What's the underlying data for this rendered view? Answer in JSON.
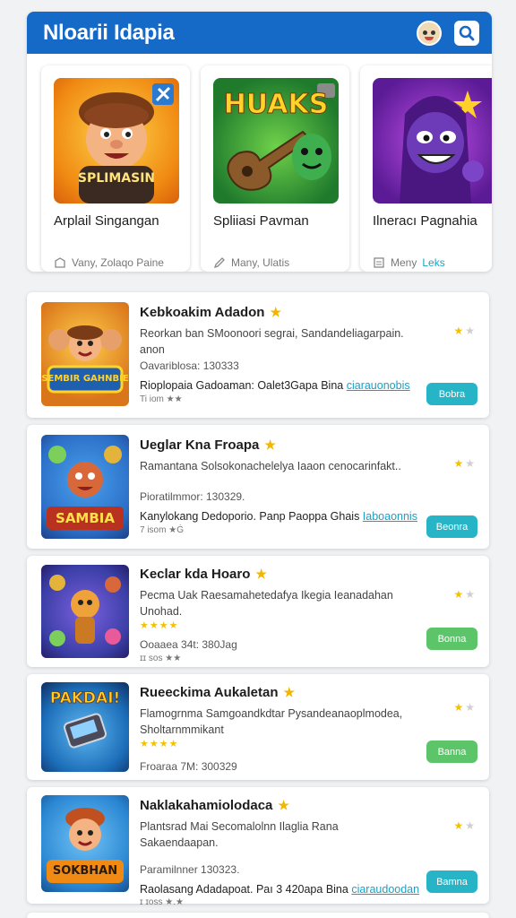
{
  "app": {
    "title": "Nloarii Idapia"
  },
  "header": {
    "avatar": "avatar",
    "search_icon": "search-icon"
  },
  "featured": [
    {
      "name": "Arplail Singangan",
      "meta": "Vany, Zolaqo Paine",
      "meta_icon": "shield-icon",
      "art_label": "SPLIMASIN",
      "bg": "#f7a21b",
      "accent": ""
    },
    {
      "name": "Spliiasi Pavman",
      "meta": "Many, Ulatis",
      "meta_icon": "pencil-icon",
      "art_label": "HUAKS",
      "bg": "#2e8c3a",
      "accent": ""
    },
    {
      "name": "Ilneracı Pagnahia",
      "meta": "Meny",
      "meta_icon": "list-icon",
      "art_label": "",
      "bg": "#7a2bb4",
      "accent": "Leks"
    }
  ],
  "list": [
    {
      "title": "Kebkoakim Adadon",
      "desc": "Reorkan ban SMoonoori segrai, Sandandeliagarpain. anon",
      "line": "Oavariblosa: 130333",
      "link_text": "Rioplopaia Gadoaman: Oalet3Gapa Bina",
      "link_u": "ciarauonobis",
      "small": "Ti iom ★★",
      "stars": "",
      "button": "Bobra",
      "btn_color": "#27b4c7",
      "art_label": "SEMBIR GAHNBIE",
      "bg": "#d9751a"
    },
    {
      "title": "Ueglar Kna Froapa",
      "desc": "Ramantana Solsokonachelelya Iaaon cenocarinfakt..",
      "line": "Pioratilmmor: 130329.",
      "link_text": "Kanylokang Dedoporio. Panp Paoppa Ghais",
      "link_u": "Iaboaonnis",
      "small": "7 isom ★Ġ",
      "stars": "",
      "button": "Beonra",
      "btn_color": "#27b4c7",
      "art_label": "SAMBIA",
      "bg": "#2b6ec6"
    },
    {
      "title": "Keclar kda Hoaro",
      "desc": "Pecma Uak Raesamahetedafya Ikegia Ieanadahan Unohad.",
      "line": "Ooaaea 34t: 380Jag",
      "link_text": "",
      "link_u": "",
      "small": "ɪɪ sos ★★",
      "stars": "★★★★",
      "button": "Bonna",
      "btn_color": "#5cc56a",
      "art_label": "",
      "bg": "#3b3fa6"
    },
    {
      "title": "Rueeckima Aukaletan",
      "desc": "Flamogrnma Samgoandkdtar Pysandeanaoplmodea, Sholtarnmmikant",
      "line": "Froaraa 7M: 300329",
      "link_text": "",
      "link_u": "",
      "small": "",
      "stars": "★★★★",
      "button": "Banna",
      "btn_color": "#5cc56a",
      "art_label": "PAKDAI!",
      "bg": "#1c6db8"
    },
    {
      "title": "Naklakahamiolodaca",
      "desc": "Plantsrad Mai Secomalolnn Ilaglia Rana Sakaendaapan.",
      "line": "Paramilnner 130323.",
      "link_text": "Raolasang Adadapoat. Paı 3 420apa Bina",
      "link_u": "ciaraudoodan",
      "small": "ɪ ɪoss ★.★",
      "stars": "",
      "button": "Bamna",
      "btn_color": "#27b4c7",
      "art_label": "SOKBHAN",
      "bg": "#2a86d2"
    }
  ]
}
